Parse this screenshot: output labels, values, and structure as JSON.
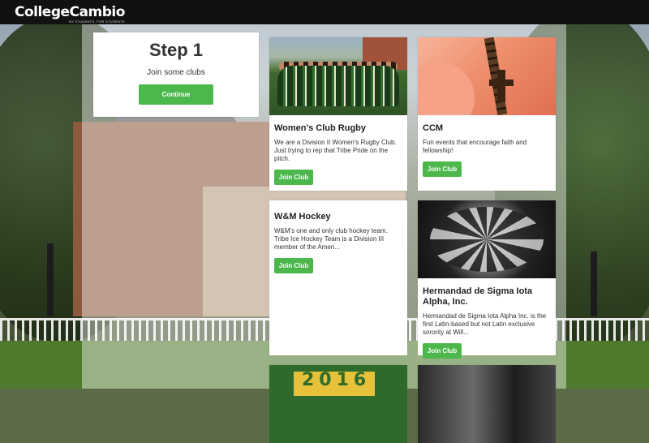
{
  "header": {
    "logo_text": "CollegeCambio",
    "logo_tagline": "BY STUDENTS, FOR STUDENTS"
  },
  "step": {
    "title": "Step 1",
    "subtitle": "Join some clubs",
    "button_label": "Continue"
  },
  "clubs": [
    {
      "name": "Women's Club Rugby",
      "description": "We are a Division II Women's Rugby Club. Just trying to rep that Tribe Pride on the pitch.",
      "button_label": "Join Club"
    },
    {
      "name": "CCM",
      "description": "Fun events that encourage faith and fellowship!",
      "button_label": "Join Club"
    },
    {
      "name": "W&M Hockey",
      "description": "W&M's one and only club hockey team. Tribe Ice Hockey Team is a Division III member of the Ameri...",
      "button_label": "Join Club"
    },
    {
      "name": "Hermandad de Sigma Iota Alpha, Inc.",
      "description": "Hermandad de Sigma Iota Alpha Inc. is the first Latin-based but not Latin exclusive sorority at Will...",
      "button_label": "Join Club"
    },
    {
      "photo_text": "2016"
    }
  ],
  "colors": {
    "accent_green": "#4cb84c",
    "topbar": "#111111"
  }
}
